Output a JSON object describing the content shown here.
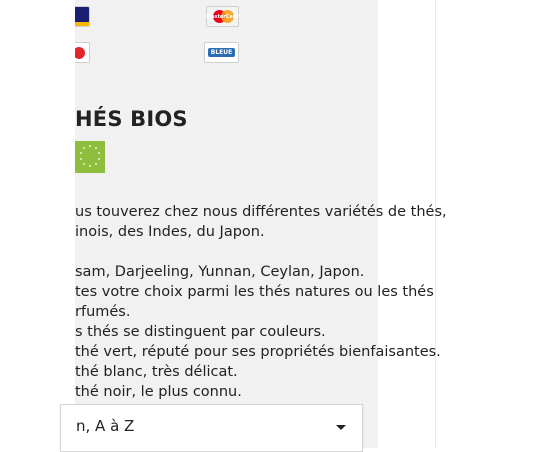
{
  "payment_methods": [
    {
      "icon": "visa-card-icon"
    },
    {
      "icon": "mastercard-icon",
      "text": "MasterCard"
    },
    {
      "icon": "cb-card-icon"
    },
    {
      "icon": "carte-bleue-icon",
      "text": "BLEUE"
    }
  ],
  "category": {
    "title": "HÉS BIOS",
    "badge_icon": "eu-organic-leaf-icon",
    "description_lines": [
      "us touverez chez nous différentes variétés de thés,",
      "inois, des Indes, du Japon.",
      "",
      "sam, Darjeeling, Yunnan, Ceylan, Japon.",
      "tes votre choix parmi les thés natures ou les thés",
      "rfumés.",
      "s thés se distinguent par couleurs.",
      " thé vert, réputé pour ses propriétés bienfaisantes.",
      " thé blanc, très délicat.",
      " thé noir, le plus connu."
    ]
  },
  "sort": {
    "selected": "n, A à Z"
  },
  "colors": {
    "panel_bg": "#f1f1f1",
    "organic_green": "#8fbe3f"
  }
}
